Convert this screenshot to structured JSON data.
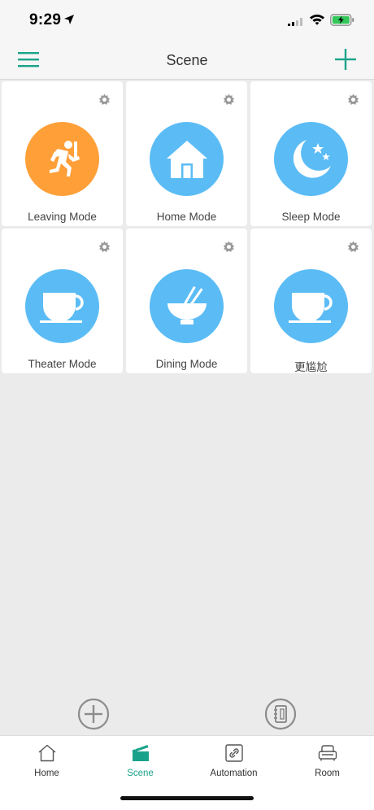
{
  "status_bar": {
    "time": "9:29"
  },
  "header": {
    "title": "Scene"
  },
  "colors": {
    "accent": "#1aa38a",
    "leaving": "#ff9f38",
    "default_scene": "#5bbcf5"
  },
  "scenes": [
    {
      "label": "Leaving Mode",
      "icon": "running-person-icon",
      "color": "#ff9f38"
    },
    {
      "label": "Home Mode",
      "icon": "house-icon",
      "color": "#5bbcf5"
    },
    {
      "label": "Sleep Mode",
      "icon": "moon-stars-icon",
      "color": "#5bbcf5"
    },
    {
      "label": "Theater Mode",
      "icon": "teacup-icon",
      "color": "#5bbcf5"
    },
    {
      "label": "Dining Mode",
      "icon": "bowl-chopsticks-icon",
      "color": "#5bbcf5"
    },
    {
      "label": "更尴尬",
      "icon": "teacup-icon",
      "color": "#5bbcf5"
    }
  ],
  "tabs": [
    {
      "label": "Home",
      "icon": "home-outline-icon",
      "active": false
    },
    {
      "label": "Scene",
      "icon": "clapperboard-icon",
      "active": true
    },
    {
      "label": "Automation",
      "icon": "link-icon",
      "active": false
    },
    {
      "label": "Room",
      "icon": "sofa-icon",
      "active": false
    }
  ]
}
